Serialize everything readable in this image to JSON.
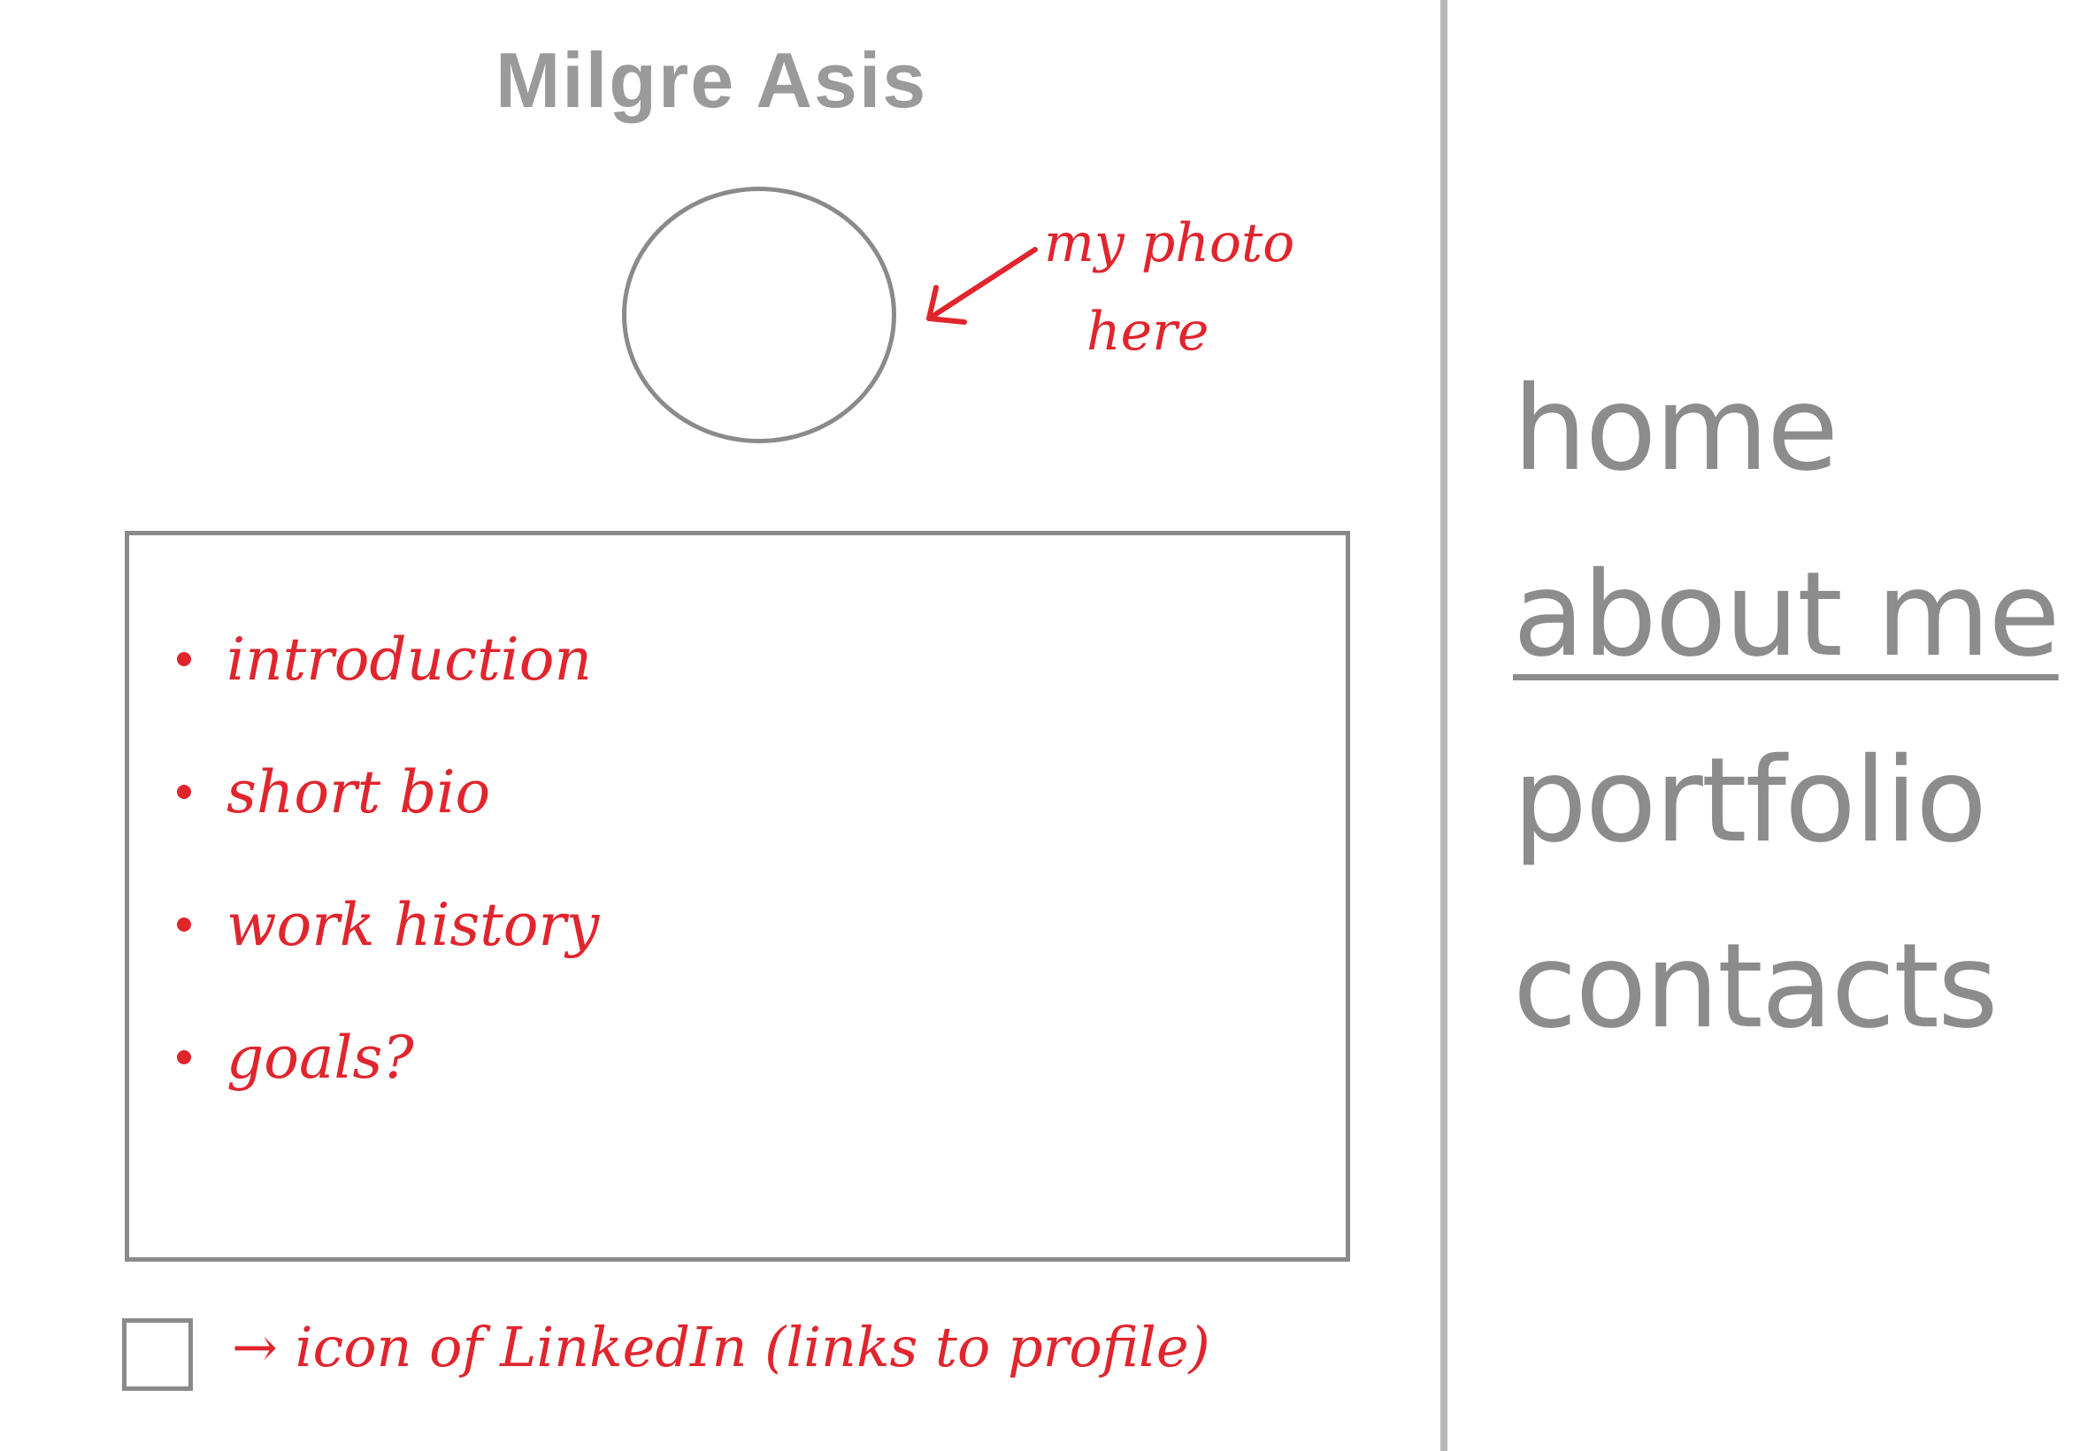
{
  "header": {
    "title": "Milgre Asis"
  },
  "photo": {
    "note_line1": "my photo",
    "note_line2": "here",
    "icon": "arrow-left-icon"
  },
  "content": {
    "items": [
      {
        "label": "introduction"
      },
      {
        "label": "short bio"
      },
      {
        "label": "work history"
      },
      {
        "label": "goals?"
      }
    ]
  },
  "linkedin": {
    "icon": "linkedin-icon",
    "note": "→ icon of LinkedIn (links to profile)"
  },
  "nav": {
    "items": [
      {
        "label": "home",
        "active": false
      },
      {
        "label": "about me",
        "active": true
      },
      {
        "label": "portfolio",
        "active": false
      },
      {
        "label": "contacts",
        "active": false
      }
    ]
  },
  "colors": {
    "annotation": "#e0252d",
    "wireframe": "#8a8a8a",
    "divider": "#b8b8b8"
  }
}
